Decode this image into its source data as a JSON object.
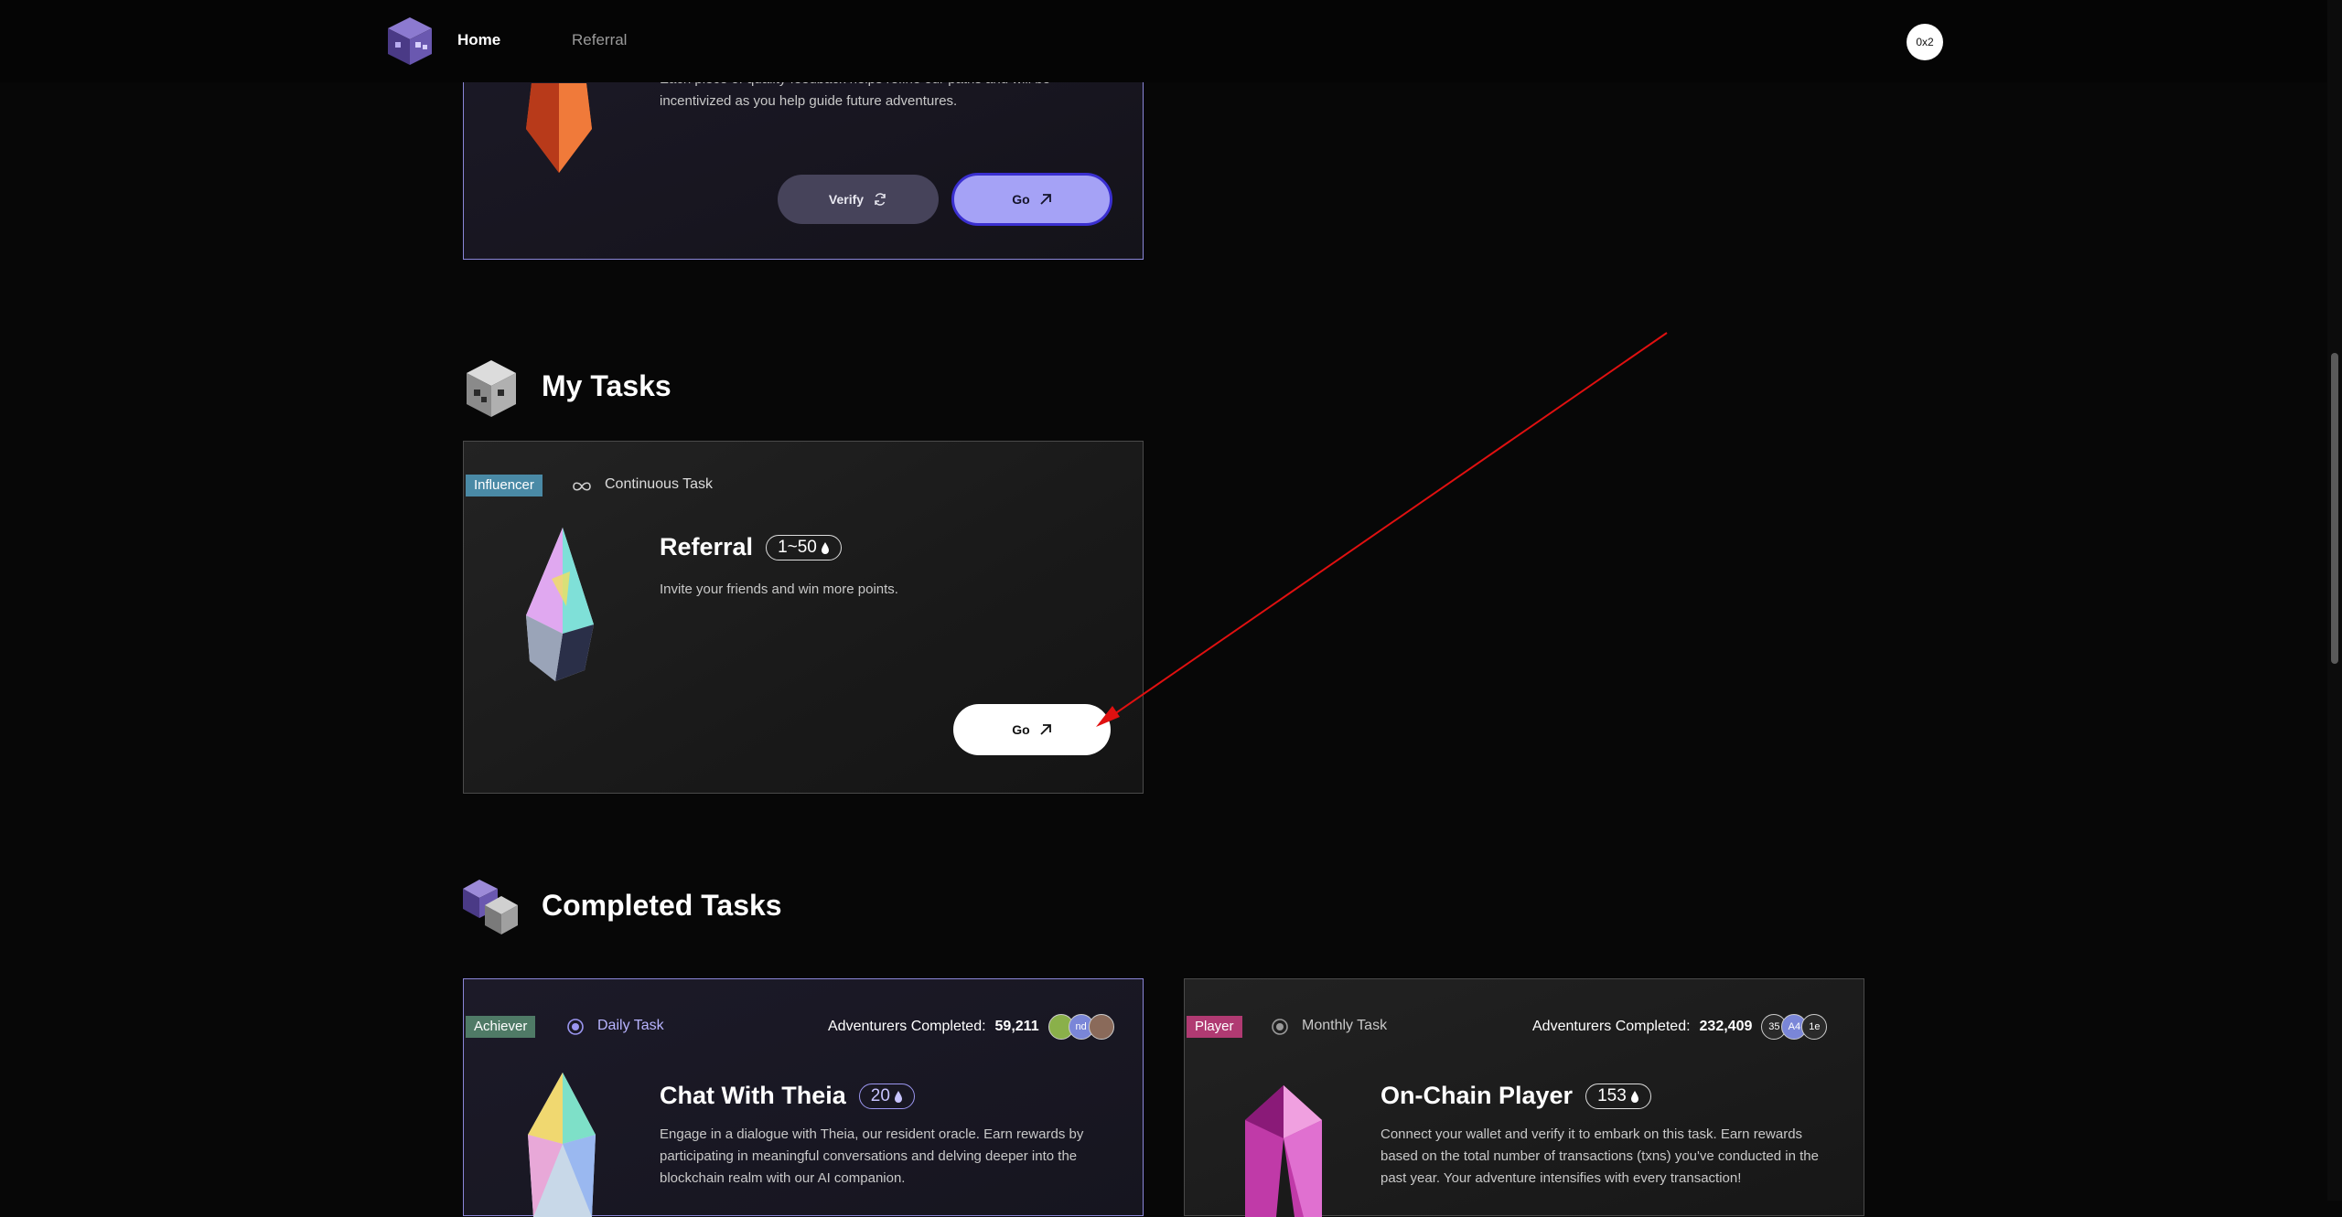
{
  "nav": {
    "home": "Home",
    "referral": "Referral",
    "wallet": "0x2"
  },
  "top_card": {
    "desc_line1": "Each piece of quality feedback helps refine our paths and will be",
    "desc_line2": "incentivized as you help guide future adventures.",
    "verify_label": "Verify",
    "go_label": "Go"
  },
  "my_tasks": {
    "title": "My Tasks",
    "card": {
      "tag": "Influencer",
      "frequency": "Continuous Task",
      "title": "Referral",
      "points": "1~50",
      "desc": "Invite your friends and win more points.",
      "go_label": "Go"
    }
  },
  "completed": {
    "title": "Completed Tasks",
    "cards": [
      {
        "tag": "Achiever",
        "frequency": "Daily Task",
        "adventurers_label": "Adventurers Completed:",
        "adventurers_count": "59,211",
        "avatars": [
          "",
          "nd",
          ""
        ],
        "title": "Chat With Theia",
        "points": "20",
        "desc_line1": "Engage in a dialogue with Theia, our resident oracle. Earn rewards by",
        "desc_line2": "participating in meaningful conversations and delving deeper into the",
        "desc_line3": "blockchain realm with our AI companion."
      },
      {
        "tag": "Player",
        "frequency": "Monthly Task",
        "adventurers_label": "Adventurers Completed:",
        "adventurers_count": "232,409",
        "avatars": [
          "35",
          "A4",
          "1e"
        ],
        "title": "On-Chain Player",
        "points": "153",
        "desc_line1": "Connect your wallet and verify it to embark on this task. Earn rewards",
        "desc_line2": "based on the total number of transactions (txns) you've conducted in the",
        "desc_line3": "past year. Your adventure intensifies with every transaction!"
      }
    ]
  },
  "colors": {
    "accent_purple": "#a5a2f6",
    "influencer_tag": "#4a8aa6",
    "achiever_tag": "#4f7a66",
    "player_tag": "#b03a72",
    "annotation_arrow": "#e01010"
  }
}
